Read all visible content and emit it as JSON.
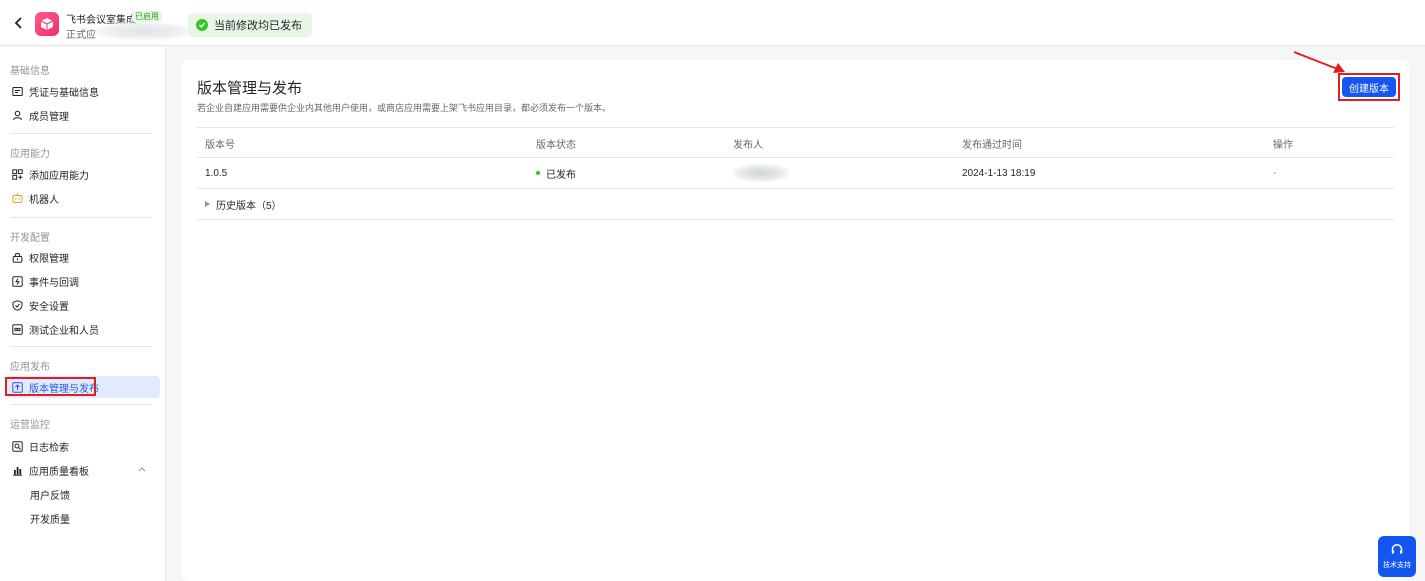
{
  "header": {
    "app_name": "飞书会议室集成",
    "app_badge": "已启用",
    "app_env": "正式应",
    "publish_tip": "当前修改均已发布"
  },
  "sidebar": {
    "sections": [
      {
        "title": "基础信息",
        "items": [
          {
            "label": "凭证与基础信息",
            "icon": "card-icon"
          },
          {
            "label": "成员管理",
            "icon": "user-icon"
          }
        ]
      },
      {
        "title": "应用能力",
        "items": [
          {
            "label": "添加应用能力",
            "icon": "grid-add-icon"
          },
          {
            "label": "机器人",
            "icon": "robot-icon"
          }
        ]
      },
      {
        "title": "开发配置",
        "items": [
          {
            "label": "权限管理",
            "icon": "lock-icon"
          },
          {
            "label": "事件与回调",
            "icon": "event-icon"
          },
          {
            "label": "安全设置",
            "icon": "shield-icon"
          },
          {
            "label": "测试企业和人员",
            "icon": "test-icon"
          }
        ]
      },
      {
        "title": "应用发布",
        "items": [
          {
            "label": "版本管理与发布",
            "icon": "upload-icon",
            "active": true
          }
        ]
      },
      {
        "title": "运营监控",
        "items": [
          {
            "label": "日志检索",
            "icon": "log-search-icon"
          },
          {
            "label": "应用质量看板",
            "icon": "chart-icon"
          },
          {
            "label": "用户反馈"
          },
          {
            "label": "开发质量"
          }
        ]
      }
    ]
  },
  "main": {
    "title": "版本管理与发布",
    "description": "若企业自建应用需要供企业内其他用户使用，或商店应用需要上架飞书应用目录，都必须发布一个版本。",
    "create_button": "创建版本",
    "table": {
      "columns": [
        "版本号",
        "版本状态",
        "发布人",
        "发布通过时间",
        "操作"
      ],
      "rows": [
        {
          "version": "1.0.5",
          "status": "已发布",
          "publisher": "",
          "time": "2024-1-13 18:19",
          "action": "-"
        }
      ],
      "history_label": "历史版本（5）"
    }
  },
  "support": {
    "label": "技术支持"
  },
  "colors": {
    "accent": "#1456f0",
    "success": "#34c724",
    "highlight": "#e02020",
    "active_bg": "#e1eaff"
  }
}
